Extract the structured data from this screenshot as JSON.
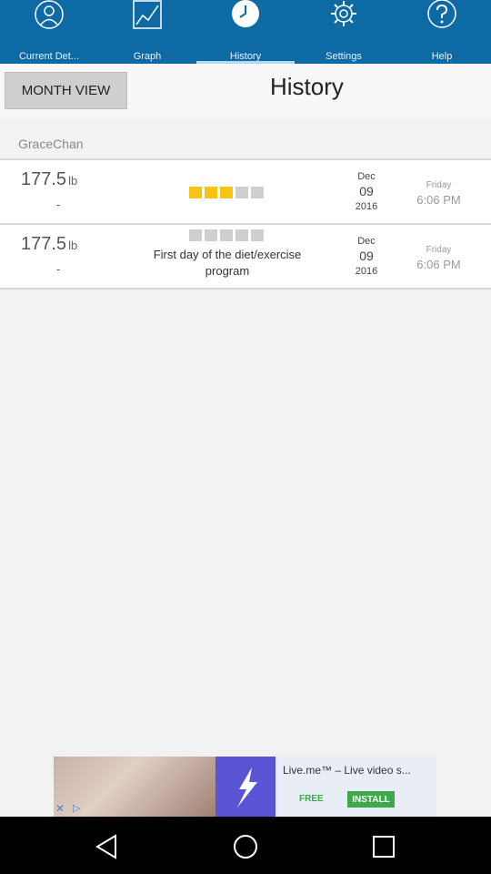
{
  "tabs": [
    {
      "label": "Current Det...",
      "icon": "person-icon",
      "active": false
    },
    {
      "label": "Graph",
      "icon": "graph-icon",
      "active": false
    },
    {
      "label": "History",
      "icon": "clock-icon",
      "active": true
    },
    {
      "label": "Settings",
      "icon": "gear-icon",
      "active": false
    },
    {
      "label": "Help",
      "icon": "help-icon",
      "active": false
    }
  ],
  "header": {
    "month_view_label": "MONTH VIEW",
    "title": "History"
  },
  "user_name": "GraceChan",
  "entries": [
    {
      "weight": "177.5",
      "unit": "lb",
      "change": "-",
      "rating": 3,
      "rating_max": 5,
      "note": "",
      "month": "Dec",
      "day": "09",
      "year": "2016",
      "weekday": "Friday",
      "time": "6:06 PM"
    },
    {
      "weight": "177.5",
      "unit": "lb",
      "change": "-",
      "rating": 0,
      "rating_max": 5,
      "note": "First day of the diet/exercise program",
      "month": "Dec",
      "day": "09",
      "year": "2016",
      "weekday": "Friday",
      "time": "6:06 PM"
    }
  ],
  "ad": {
    "title": "Live.me™ – Live video s...",
    "free_label": "FREE",
    "install_label": "INSTALL"
  },
  "colors": {
    "tab_bar": "#0d6aa5",
    "rating_on": "#f5c516",
    "rating_off": "#cfcfcf"
  }
}
